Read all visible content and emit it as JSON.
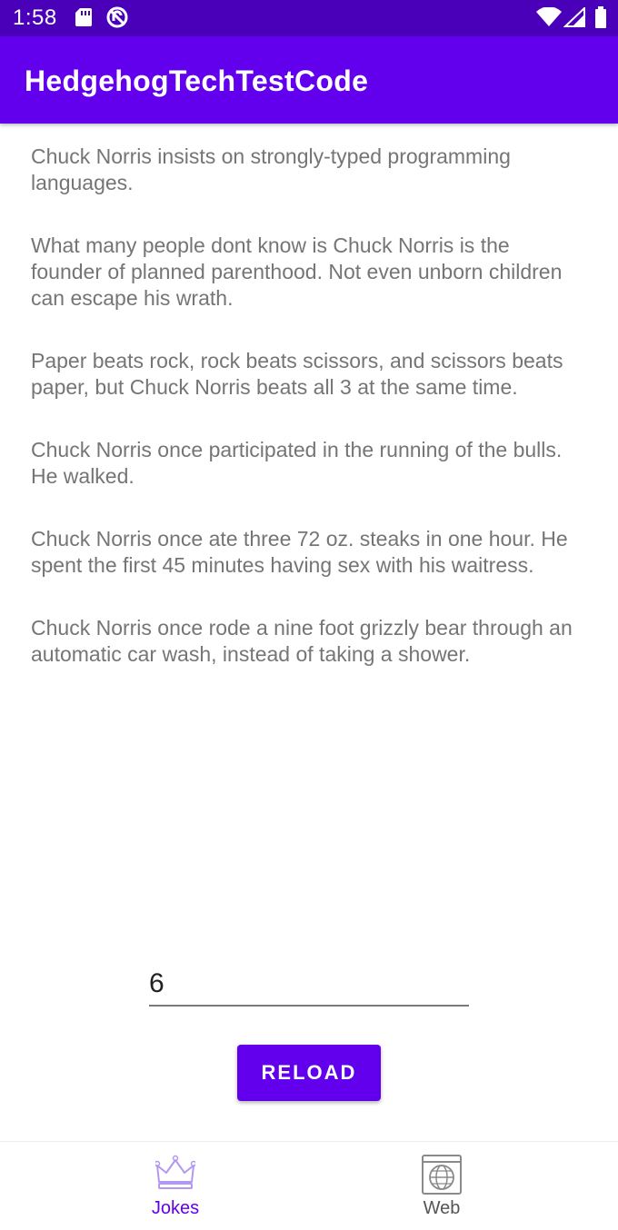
{
  "status_bar": {
    "time": "1:58",
    "icons": [
      "sd-card-icon",
      "vpn-icon",
      "wifi-icon",
      "signal-icon",
      "battery-icon"
    ]
  },
  "app_bar": {
    "title": "HedgehogTechTestCode"
  },
  "jokes": [
    "Chuck Norris insists on strongly-typed programming languages.",
    "What many people dont know is Chuck Norris is the founder of planned parenthood. Not even unborn children can escape his wrath.",
    "Paper beats rock, rock beats scissors, and scissors beats paper, but Chuck Norris beats all 3 at the same time.",
    "Chuck Norris once participated in the running of the bulls. He walked.",
    "Chuck Norris once ate three 72 oz. steaks in one hour. He spent the first 45 minutes having sex with his waitress.",
    "Chuck Norris once rode a nine foot grizzly bear through an automatic car wash, instead of taking a shower."
  ],
  "count_field": {
    "value": "6"
  },
  "reload_button": {
    "label": "RELOAD"
  },
  "bottom_nav": {
    "items": [
      {
        "label": "Jokes",
        "icon": "crown-icon",
        "active": true
      },
      {
        "label": "Web",
        "icon": "globe-window-icon",
        "active": false
      }
    ]
  },
  "colors": {
    "status_bar": "#4a00b8",
    "primary": "#6200ee",
    "joke_text": "#757575"
  }
}
